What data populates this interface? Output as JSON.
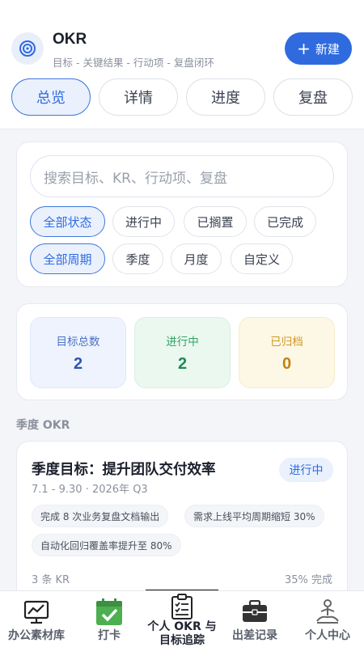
{
  "header": {
    "title": "OKR",
    "subtitle": "目标 - 关键结果 - 行动项 - 复盘闭环",
    "new_button": "新建",
    "new_button_plus": "+"
  },
  "tabs": [
    {
      "label": "总览",
      "active": true
    },
    {
      "label": "详情",
      "active": false
    },
    {
      "label": "进度",
      "active": false
    },
    {
      "label": "复盘",
      "active": false
    }
  ],
  "filters": {
    "search_placeholder": "搜索目标、KR、行动项、复盘",
    "status": [
      "全部状态",
      "进行中",
      "已搁置",
      "已完成"
    ],
    "period": [
      "全部周期",
      "季度",
      "月度",
      "自定义"
    ]
  },
  "stats": {
    "total": {
      "label": "目标总数",
      "value": "2"
    },
    "in_progress": {
      "label": "进行中",
      "value": "2"
    },
    "archived": {
      "label": "已归档",
      "value": "0"
    }
  },
  "section_title": "季度 OKR",
  "okr": {
    "title": "季度目标：提升团队交付效率",
    "status": "进行中",
    "period": "7.1 - 9.30 · 2026年 Q3",
    "krs": [
      "完成 8 次业务复盘文档输出",
      "需求上线平均周期缩短 30%",
      "自动化回归覆盖率提升至 80%"
    ],
    "kr_count": "3 条 KR",
    "progress_text": "35% 完成",
    "progress": 0.35
  },
  "nav": [
    {
      "label": "办公素材库",
      "icon": "chart-monitor-icon"
    },
    {
      "label": "打卡",
      "icon": "check-calendar-icon"
    },
    {
      "label": "个人 OKR 与目标追踪",
      "icon": "clipboard-list-icon",
      "active": true
    },
    {
      "label": "出差记录",
      "icon": "briefcase-icon"
    },
    {
      "label": "个人中心",
      "icon": "meditation-person-icon"
    }
  ],
  "colors": {
    "accent": "#2f6bdf",
    "green": "#1f8a52",
    "yellow": "#c08412",
    "progress": "#f0a023"
  }
}
